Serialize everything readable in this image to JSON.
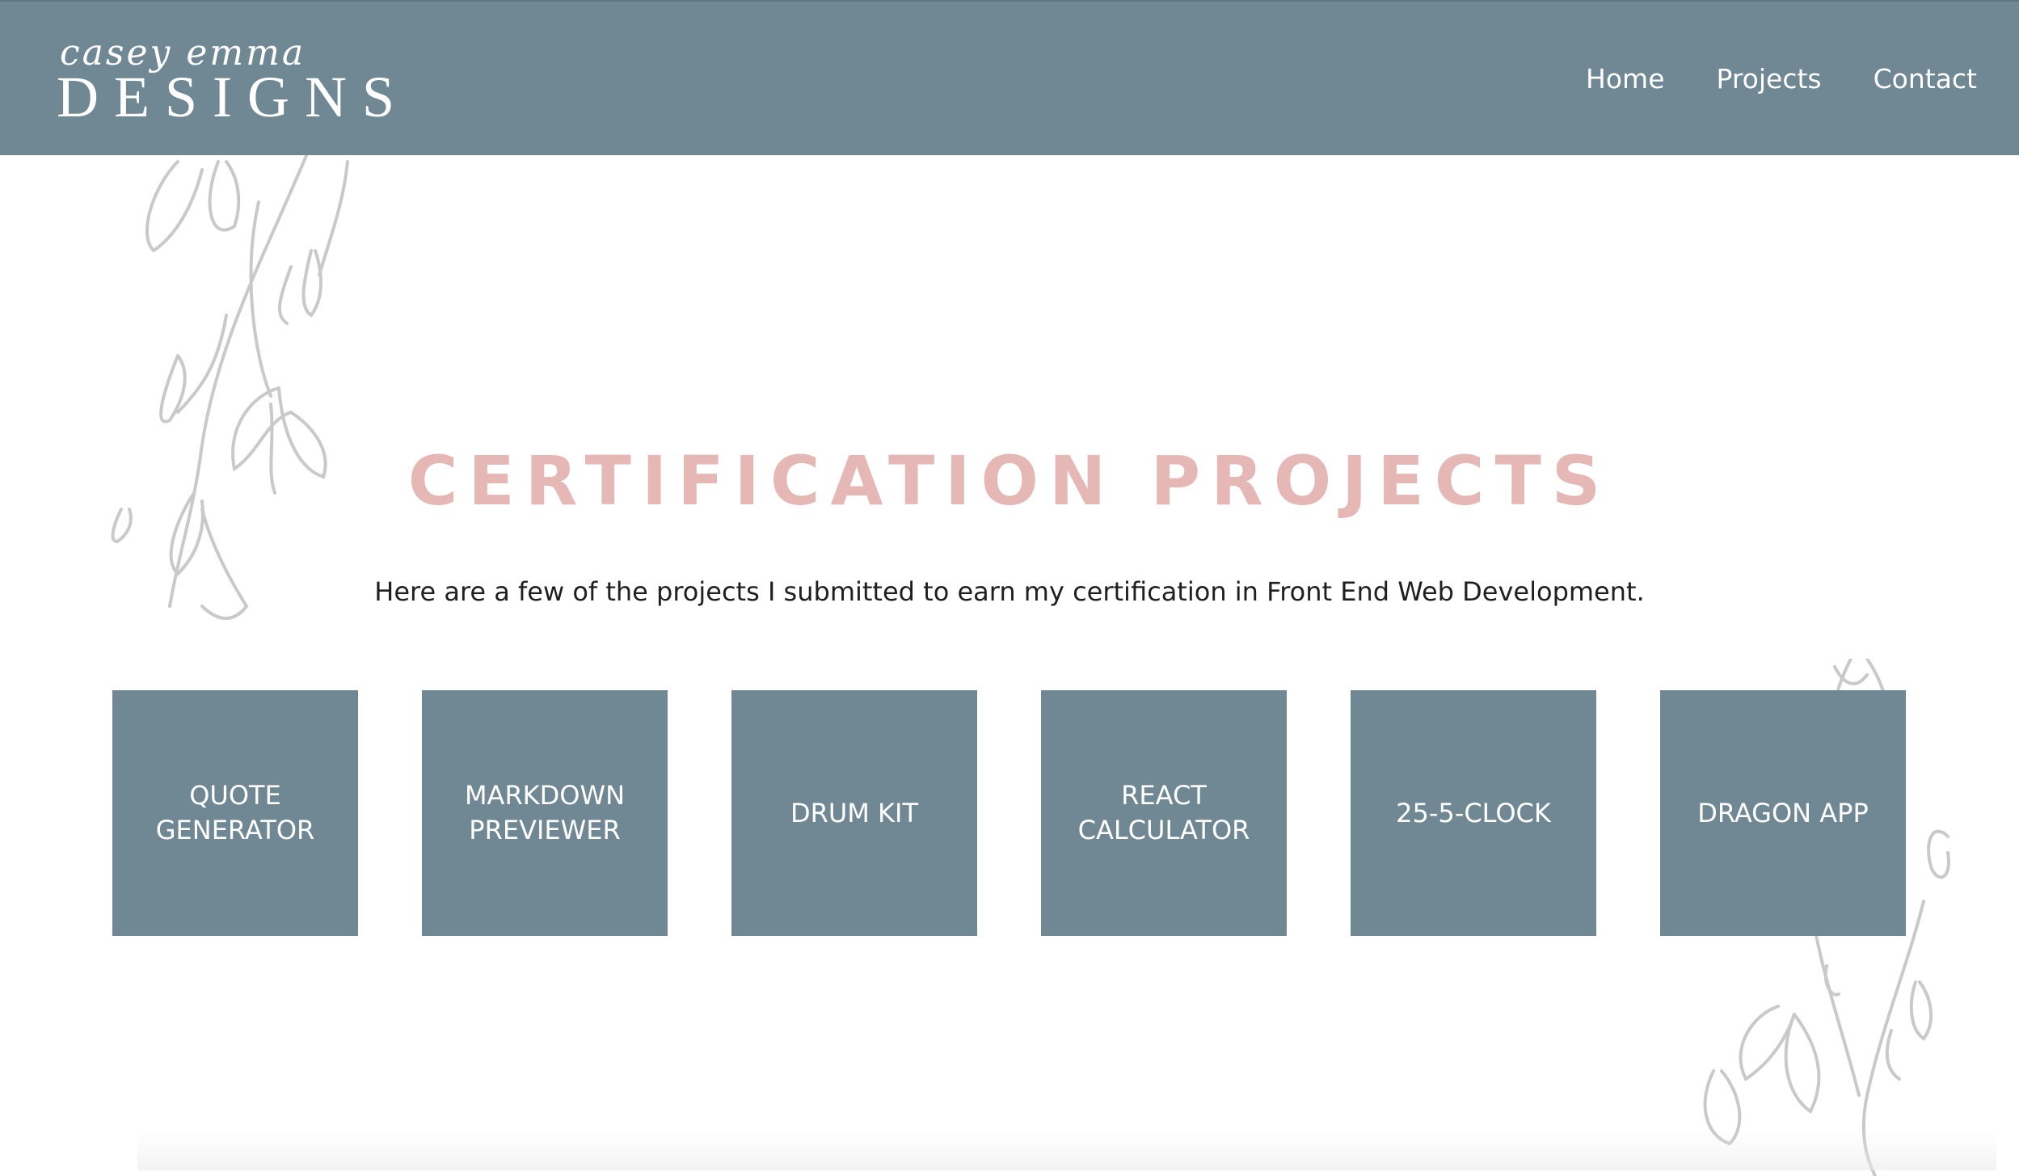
{
  "brand": {
    "logo_script": "casey emma",
    "logo_word": "DESIGNS"
  },
  "nav": {
    "items": [
      {
        "label": "Home"
      },
      {
        "label": "Projects"
      },
      {
        "label": "Contact"
      }
    ]
  },
  "main": {
    "title": "CERTIFICATION PROJECTS",
    "subtitle": "Here are a few of the projects I submitted to earn my certification in Front End Web Development."
  },
  "projects": [
    {
      "label": "QUOTE GENERATOR"
    },
    {
      "label": "MARKDOWN PREVIEWER"
    },
    {
      "label": "DRUM KIT"
    },
    {
      "label": "REACT CALCULATOR"
    },
    {
      "label": "25-5-CLOCK"
    },
    {
      "label": "DRAGON APP"
    }
  ],
  "colors": {
    "header_bg": "#708893",
    "tile_bg": "#708893",
    "title": "#e5b7b5",
    "floral": "#c9c9c9"
  },
  "icons": {
    "logo": "brand-logo",
    "floral_left": "floral-illustration",
    "floral_right": "floral-illustration"
  }
}
